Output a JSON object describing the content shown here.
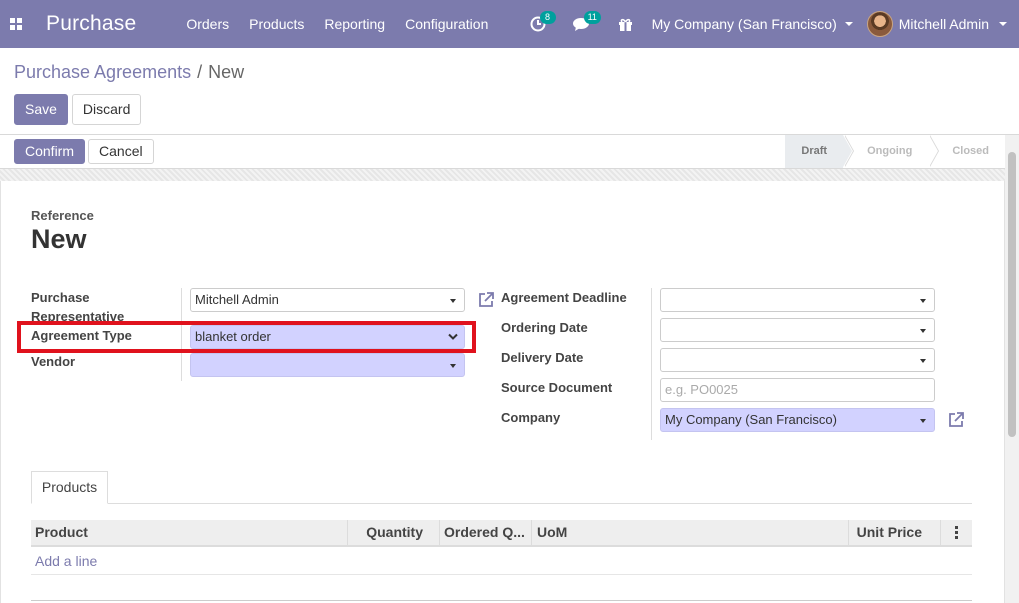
{
  "navbar": {
    "app_name": "Purchase",
    "menu": [
      "Orders",
      "Products",
      "Reporting",
      "Configuration"
    ],
    "activity_badge": "8",
    "messages_badge": "11",
    "company": "My Company (San Francisco)",
    "user": "Mitchell Admin",
    "color": "#7c7bad"
  },
  "breadcrumb": {
    "parent": "Purchase Agreements",
    "separator": "/",
    "current": "New"
  },
  "control_panel": {
    "save_label": "Save",
    "discard_label": "Discard"
  },
  "statusbar": {
    "confirm_label": "Confirm",
    "cancel_label": "Cancel",
    "stages": [
      "Draft",
      "Ongoing",
      "Closed"
    ],
    "current_stage": "Draft"
  },
  "form": {
    "reference_label": "Reference",
    "reference_value": "New",
    "left": {
      "purchase_rep_label_1": "Purchase",
      "purchase_rep_label_2": "Representative",
      "purchase_rep_value": "Mitchell Admin",
      "agreement_type_label": "Agreement Type",
      "agreement_type_value": "blanket order",
      "vendor_label": "Vendor",
      "vendor_value": ""
    },
    "right": {
      "deadline_label": "Agreement Deadline",
      "ordering_date_label": "Ordering Date",
      "delivery_date_label": "Delivery Date",
      "source_doc_label": "Source Document",
      "source_doc_placeholder": "e.g. PO0025",
      "company_label": "Company",
      "company_value": "My Company (San Francisco)"
    }
  },
  "notebook": {
    "tab_products": "Products",
    "columns": [
      "Product",
      "Quantity",
      "Ordered Q...",
      "UoM",
      "Unit Price"
    ],
    "add_line": "Add a line"
  }
}
